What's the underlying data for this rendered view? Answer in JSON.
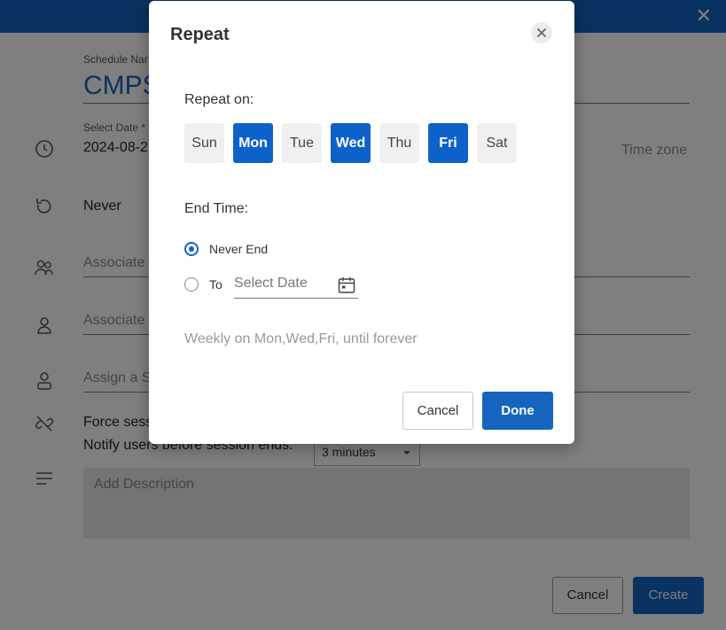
{
  "background": {
    "schedule_name_label": "Schedule Nar",
    "schedule_name_value": "CMPS",
    "select_date_label": "Select Date *",
    "select_date_value": "2024-08-2",
    "time_zone": "Time zone",
    "repeat_value": "Never",
    "associate_1": "Associate",
    "associate_2": "Associate",
    "assign": "Assign a S",
    "force_session": "Force sess",
    "notify_users": "Notify users before session ends:",
    "notify_select": "3 minutes",
    "description_placeholder": "Add Description",
    "cancel_label": "Cancel",
    "create_label": "Create"
  },
  "modal": {
    "title": "Repeat",
    "repeat_on_label": "Repeat on:",
    "days": [
      {
        "label": "Sun",
        "selected": false
      },
      {
        "label": "Mon",
        "selected": true
      },
      {
        "label": "Tue",
        "selected": false
      },
      {
        "label": "Wed",
        "selected": true
      },
      {
        "label": "Thu",
        "selected": false
      },
      {
        "label": "Fri",
        "selected": true
      },
      {
        "label": "Sat",
        "selected": false
      }
    ],
    "end_time_label": "End Time:",
    "never_end_label": "Never End",
    "to_label": "To",
    "date_placeholder": "Select Date",
    "summary": "Weekly on Mon,Wed,Fri, until forever",
    "cancel_label": "Cancel",
    "done_label": "Done"
  },
  "colors": {
    "accent": "#1565c0",
    "day_selected": "#0d62c9"
  }
}
